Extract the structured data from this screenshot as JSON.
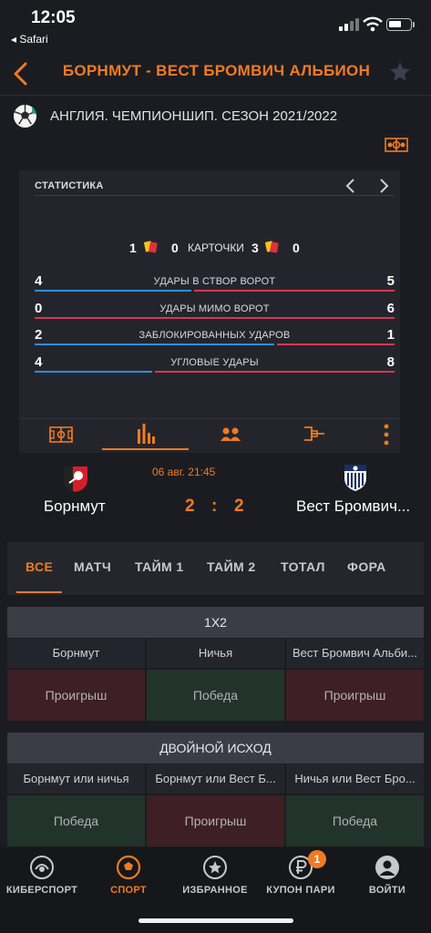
{
  "status_bar": {
    "time": "12:05",
    "back_app": "◂ Safari"
  },
  "header": {
    "title": "БОРНМУТ - ВЕСТ БРОМВИЧ АЛЬБИОН"
  },
  "league": {
    "name": "АНГЛИЯ. ЧЕМПИОНШИП. СЕЗОН 2021/2022"
  },
  "stats": {
    "title": "СТАТИСТИКА",
    "cards": {
      "label": "КАРТОЧКИ",
      "home_yellow": "1",
      "home_red": "0",
      "away_yellow": "3",
      "away_red": "0"
    },
    "rows": [
      {
        "label": "УДАРЫ В СТВОР ВОРОТ",
        "home": "4",
        "away": "5",
        "home_share": 0.44
      },
      {
        "label": "УДАРЫ МИМО ВОРОТ",
        "home": "0",
        "away": "6",
        "home_share": 0.0
      },
      {
        "label": "ЗАБЛОКИРОВАННЫХ УДАРОВ",
        "home": "2",
        "away": "1",
        "home_share": 0.67
      },
      {
        "label": "УГЛОВЫЕ УДАРЫ",
        "home": "4",
        "away": "8",
        "home_share": 0.33
      }
    ],
    "home_color": "#2d8fd8",
    "away_color": "#d8364f"
  },
  "match": {
    "date": "06 авг. 21:45",
    "home_team": "Борнмут",
    "away_team": "Вест Бромвич...",
    "home_score": "2",
    "separator": ":",
    "away_score": "2"
  },
  "market_tabs": [
    {
      "label": "ВСЕ",
      "active": true
    },
    {
      "label": "МАТЧ"
    },
    {
      "label": "ТАЙМ 1"
    },
    {
      "label": "ТАЙМ 2"
    },
    {
      "label": "ТОТАЛ"
    },
    {
      "label": "ФОРА"
    }
  ],
  "markets": [
    {
      "title": "1X2",
      "columns": [
        "Борнмут",
        "Ничья",
        "Вест Бромвич Альби..."
      ],
      "results": [
        "Проигрыш",
        "Победа",
        "Проигрыш"
      ]
    },
    {
      "title": "ДВОЙНОЙ ИСХОД",
      "columns": [
        "Борнмут или ничья",
        "Борнмут или Вест Б...",
        "Ничья или Вест Бро..."
      ],
      "results": [
        "Победа",
        "Проигрыш",
        "Победа"
      ]
    }
  ],
  "nav": [
    {
      "label": "КИБЕРСПОРТ",
      "icon": "esports-icon"
    },
    {
      "label": "СПОРТ",
      "icon": "sport-ball-icon",
      "active": true
    },
    {
      "label": "ИЗБРАННОЕ",
      "icon": "star-icon"
    },
    {
      "label": "КУПОН ПАРИ",
      "icon": "ruble-coupon-icon",
      "badge": "1"
    },
    {
      "label": "ВОЙТИ",
      "icon": "user-icon"
    }
  ],
  "colors": {
    "accent": "#f07b22",
    "win_bg": "#22332c",
    "lose_bg": "#3d1f25"
  }
}
